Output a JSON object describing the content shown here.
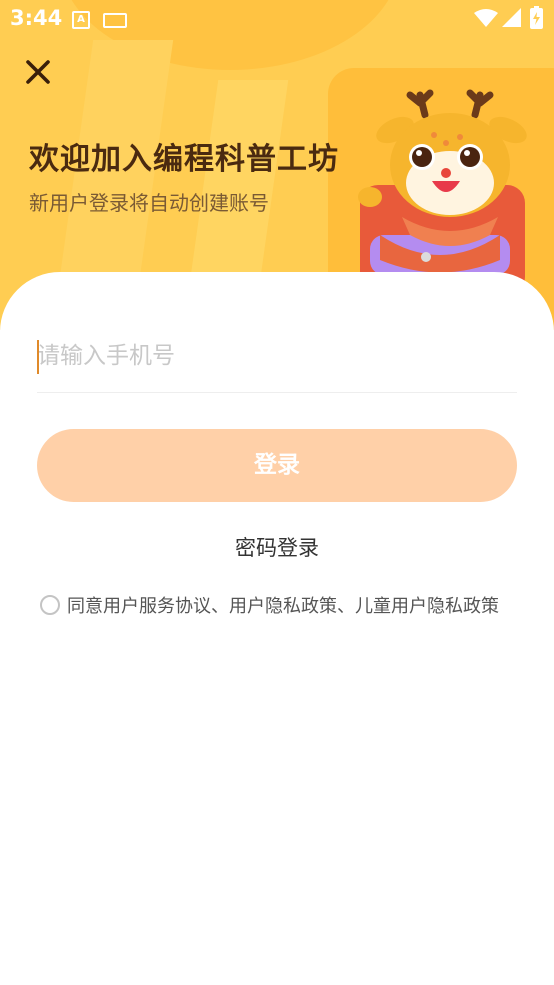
{
  "status_bar": {
    "time": "3:44",
    "icons": [
      "a-notification-icon",
      "keyboard-icon",
      "wifi-icon",
      "signal-icon",
      "battery-charging-icon"
    ]
  },
  "header": {
    "title": "欢迎加入编程科普工坊",
    "subtitle": "新用户登录将自动创建账号"
  },
  "form": {
    "phone_placeholder": "请输入手机号",
    "phone_value": "",
    "login_label": "登录",
    "password_login_label": "密码登录"
  },
  "agreement": {
    "prefix": "同意",
    "user_service": "用户服务协议",
    "sep1": "、",
    "user_privacy": "用户隐私政策",
    "sep2": "、",
    "child_privacy": "儿童用户隐私政策",
    "checked": false
  },
  "colors": {
    "hero_bg": "#ffcd52",
    "title": "#4a2a10",
    "login_button": "#ffd0a8",
    "caret": "#e08a2a"
  }
}
